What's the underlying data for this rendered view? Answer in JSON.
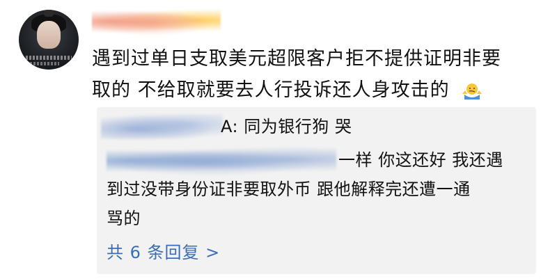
{
  "comment": {
    "username": "",
    "line1": "遇到过单日支取美元超限客户拒不提供证明非要",
    "line2": "取的 不给取就要去人行投诉还人身攻击的",
    "emoji": "shrug-emoji"
  },
  "reply": {
    "first_name_suffix": "A: 同为银行狗 哭",
    "second_line1": "一样 你这还好 我还遇",
    "second_line2": "到过没带身份证非要取外币 跟他解释完还遭一通",
    "second_line3": "骂的",
    "more_label": "共 6 条回复 >"
  },
  "colors": {
    "link": "#3a6db5",
    "reply_bg": "#f2f2f2"
  }
}
